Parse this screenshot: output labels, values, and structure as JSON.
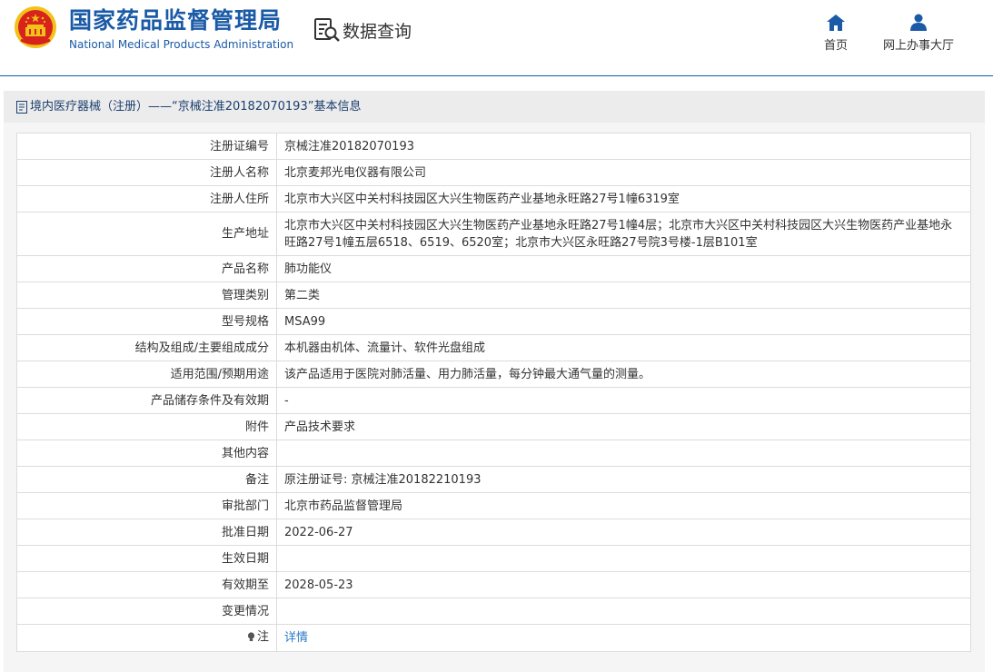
{
  "header": {
    "logo_cn": "国家药品监督管理局",
    "logo_en": "National Medical Products Administration",
    "data_query_label": "数据查询",
    "nav": [
      {
        "icon": "home-icon",
        "label": "首页"
      },
      {
        "icon": "user-icon",
        "label": "网上办事大厅"
      }
    ]
  },
  "panel": {
    "title": "境内医疗器械（注册）——“京械注准20182070193”基本信息"
  },
  "rows": [
    {
      "label": "注册证编号",
      "value": "京械注准20182070193"
    },
    {
      "label": "注册人名称",
      "value": "北京麦邦光电仪器有限公司"
    },
    {
      "label": "注册人住所",
      "value": "北京市大兴区中关村科技园区大兴生物医药产业基地永旺路27号1幢6319室"
    },
    {
      "label": "生产地址",
      "value": "北京市大兴区中关村科技园区大兴生物医药产业基地永旺路27号1幢4层；北京市大兴区中关村科技园区大兴生物医药产业基地永旺路27号1幢五层6518、6519、6520室；北京市大兴区永旺路27号院3号楼-1层B101室"
    },
    {
      "label": "产品名称",
      "value": "肺功能仪"
    },
    {
      "label": "管理类别",
      "value": "第二类"
    },
    {
      "label": "型号规格",
      "value": "MSA99"
    },
    {
      "label": "结构及组成/主要组成成分",
      "value": "本机器由机体、流量计、软件光盘组成"
    },
    {
      "label": "适用范围/预期用途",
      "value": "该产品适用于医院对肺活量、用力肺活量，每分钟最大通气量的测量。"
    },
    {
      "label": "产品储存条件及有效期",
      "value": "-"
    },
    {
      "label": "附件",
      "value": "产品技术要求"
    },
    {
      "label": "其他内容",
      "value": ""
    },
    {
      "label": "备注",
      "value": "原注册证号: 京械注准20182210193"
    },
    {
      "label": "审批部门",
      "value": "北京市药品监督管理局"
    },
    {
      "label": "批准日期",
      "value": "2022-06-27"
    },
    {
      "label": "生效日期",
      "value": ""
    },
    {
      "label": "有效期至",
      "value": "2028-05-23"
    },
    {
      "label": "变更情况",
      "value": ""
    }
  ],
  "note_row": {
    "label": "注",
    "link": "详情"
  },
  "colors": {
    "brand_blue": "#1a5aa6",
    "link_blue": "#2b78c6",
    "emblem_red": "#d7231c",
    "emblem_gold": "#f2c21a"
  }
}
